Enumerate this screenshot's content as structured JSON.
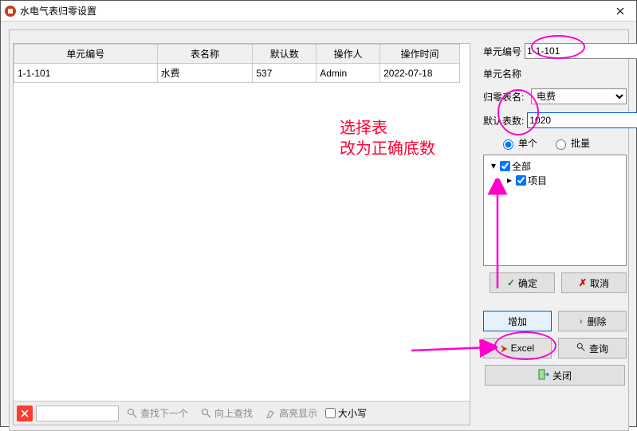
{
  "window": {
    "title": "水电气表归零设置"
  },
  "table": {
    "headers": [
      "单元编号",
      "表名称",
      "默认数",
      "操作人",
      "操作时间"
    ],
    "rows": [
      {
        "unitNo": "1-1-101",
        "meterName": "水费",
        "defaultVal": "537",
        "operator": "Admin",
        "opTime": "2022-07-18"
      }
    ]
  },
  "searchBar": {
    "value": "",
    "findNext": "查找下一个",
    "findPrev": "向上查找",
    "highlight": "高亮显示",
    "caseSensitive": "大小写"
  },
  "form": {
    "unitNoLabel": "单元编号",
    "unitNoValue": "1-1-101",
    "unitNameLabel": "单元名称",
    "unitNameValue": "",
    "meterLabel": "归零表名:",
    "meterValue": "电费",
    "meterOptions": [
      "电费"
    ],
    "defaultLabel": "默认表数:",
    "defaultValue": "1020",
    "radioSingle": "单个",
    "radioBatch": "批量",
    "radioSelected": "single"
  },
  "tree": {
    "root": "全部",
    "child": "项目"
  },
  "buttons": {
    "ok": "确定",
    "cancel": "取消",
    "add": "增加",
    "delete": "删除",
    "excel": "Excel",
    "query": "查询",
    "close": "关闭"
  },
  "annotations": {
    "line1": "选择表",
    "line2": "改为正确底数"
  },
  "colors": {
    "annotationText": "#ff0033",
    "annotationOval": "#ff00cc",
    "accentBlue": "#0054ff"
  }
}
